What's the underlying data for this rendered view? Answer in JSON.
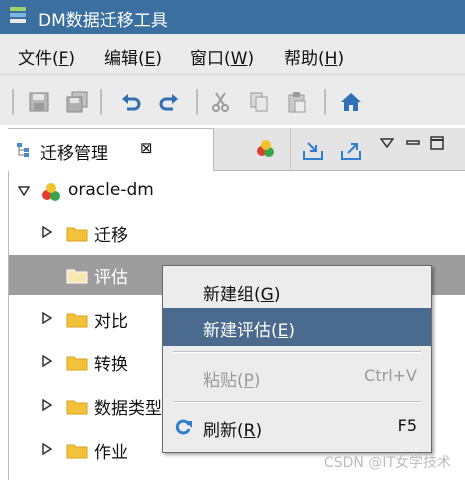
{
  "window": {
    "title": "DM数据迁移工具"
  },
  "menubar": [
    {
      "label": "文件",
      "mnemonic": "F"
    },
    {
      "label": "编辑",
      "mnemonic": "E"
    },
    {
      "label": "窗口",
      "mnemonic": "W"
    },
    {
      "label": "帮助",
      "mnemonic": "H"
    }
  ],
  "toolbar": {
    "icons": [
      "save-icon",
      "save-all-icon",
      "undo-icon",
      "redo-icon",
      "cut-icon",
      "copy-icon",
      "paste-icon",
      "home-icon"
    ]
  },
  "panel": {
    "tab_title": "迁移管理",
    "tab_close": "⊠"
  },
  "tree": {
    "root": "oracle-dm",
    "children": [
      {
        "label": "迁移",
        "expandable": true
      },
      {
        "label": "评估",
        "expandable": false,
        "selected": true
      },
      {
        "label": "对比",
        "expandable": true
      },
      {
        "label": "转换",
        "expandable": true
      },
      {
        "label": "数据类型",
        "expandable": true
      },
      {
        "label": "作业",
        "expandable": true
      }
    ]
  },
  "context_menu": {
    "items": [
      {
        "label": "新建组",
        "mnemonic": "G",
        "shortcut": "",
        "state": "normal"
      },
      {
        "label": "新建评估",
        "mnemonic": "E",
        "shortcut": "",
        "state": "hover"
      },
      {
        "label": "粘贴",
        "mnemonic": "P",
        "shortcut": "Ctrl+V",
        "state": "disabled"
      },
      {
        "label": "刷新",
        "mnemonic": "R",
        "shortcut": "F5",
        "state": "normal"
      }
    ]
  },
  "watermark": "CSDN @IT女学技术",
  "colors": {
    "titlebar": "#3a6fa0",
    "menu_hover": "#4b6b8e",
    "selected_row": "#9d9d9d",
    "folder": "#f2c33a",
    "toolbar_icon": "#2f6fb5"
  }
}
